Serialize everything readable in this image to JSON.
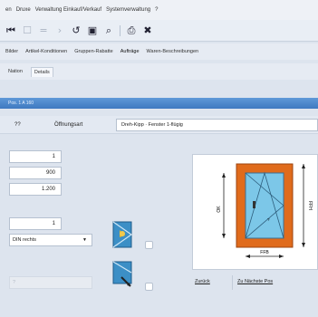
{
  "menu": {
    "items": [
      "en",
      "Druxe",
      "Verwaltung Einkauf/Verkauf",
      "Systemverwaltung",
      "?"
    ]
  },
  "tabs_top": [
    "Bilder",
    "Artikel-Konditionen",
    "Gruppen-Rabatte",
    "Aufträge",
    "Waren-Beschreibungen"
  ],
  "tabs_second": [
    "Nation",
    "Details"
  ],
  "blue_bar": {
    "text": "Pos. 1 A 160"
  },
  "header_row": {
    "col1": "??",
    "col2": "Öffnungsart",
    "value": "Dreh-Kipp · Fenster 1-flügig"
  },
  "inputs": {
    "qty": "1",
    "width": "900",
    "height": "1.200",
    "count": "1",
    "din_select": "DIN rechts",
    "disabled_text": "?"
  },
  "diagram": {
    "width_label": "FFB",
    "height_label_left": "OK",
    "height_label_right": "FFH",
    "sash_label": "?"
  },
  "footer": {
    "back_label": "Zurück",
    "next_label": "Zu Nächste Pos"
  },
  "colors": {
    "frame_orange": "#e06b1c",
    "glass_blue": "#7cc7e8",
    "title_bar": "#4a86cc"
  }
}
